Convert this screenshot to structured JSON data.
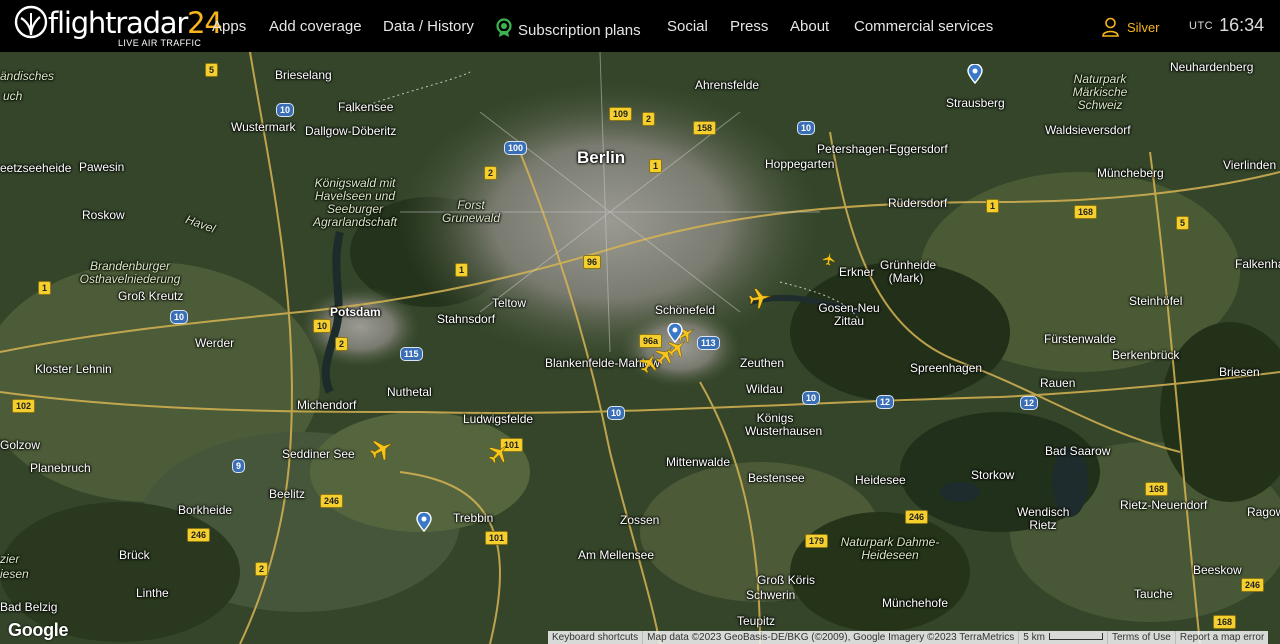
{
  "header": {
    "logo_text": "flightradar",
    "logo_number": "24",
    "logo_tagline": "LIVE AIR TRAFFIC",
    "nav": [
      {
        "label": "Apps"
      },
      {
        "label": "Add coverage"
      },
      {
        "label": "Data / History"
      },
      {
        "label": "Subscription plans"
      },
      {
        "label": "Social"
      },
      {
        "label": "Press"
      },
      {
        "label": "About"
      },
      {
        "label": "Commercial services"
      }
    ],
    "account_label": "Silver",
    "clock_zone": "UTC",
    "clock_time": "16:34",
    "accent_color": "#f8b61c"
  },
  "map": {
    "places": [
      {
        "name": "Berlin"
      },
      {
        "name": "Potsdam"
      },
      {
        "name": "Brieselang"
      },
      {
        "name": "Falkensee"
      },
      {
        "name": "Wustermark"
      },
      {
        "name": "Dallgow-Döberitz"
      },
      {
        "name": "Ahrensfelde"
      },
      {
        "name": "Hoppegarten"
      },
      {
        "name": "Petershagen-Eggersdorf"
      },
      {
        "name": "Strausberg"
      },
      {
        "name": "Neuhardenberg"
      },
      {
        "name": "Waldsieversdorf"
      },
      {
        "name": "Müncheberg"
      },
      {
        "name": "Vierlinden"
      },
      {
        "name": "Rüdersdorf"
      },
      {
        "name": "Erkner"
      },
      {
        "name": "Grünheide (Mark)"
      },
      {
        "name": "Gosen-Neu Zittau"
      },
      {
        "name": "Steinhöfel"
      },
      {
        "name": "Falkenha"
      },
      {
        "name": "Fürstenwalde"
      },
      {
        "name": "Berkenbrück"
      },
      {
        "name": "Briesen"
      },
      {
        "name": "Rauen"
      },
      {
        "name": "Spreenhagen"
      },
      {
        "name": "Schönefeld"
      },
      {
        "name": "Blankenfelde-Mahlow"
      },
      {
        "name": "Zeuthen"
      },
      {
        "name": "Wildau"
      },
      {
        "name": "Königs Wusterhausen"
      },
      {
        "name": "Teltow"
      },
      {
        "name": "Stahnsdorf"
      },
      {
        "name": "Nuthetal"
      },
      {
        "name": "Michendorf"
      },
      {
        "name": "Ludwigsfelde"
      },
      {
        "name": "Seddiner See"
      },
      {
        "name": "Beelitz"
      },
      {
        "name": "Trebbin"
      },
      {
        "name": "Mittenwalde"
      },
      {
        "name": "Bestensee"
      },
      {
        "name": "Heidesee"
      },
      {
        "name": "Storkow"
      },
      {
        "name": "Bad Saarow"
      },
      {
        "name": "Wendisch Rietz"
      },
      {
        "name": "Rietz-Neuendorf"
      },
      {
        "name": "Ragow"
      },
      {
        "name": "Beeskow"
      },
      {
        "name": "Tauche"
      },
      {
        "name": "Münchehofe"
      },
      {
        "name": "Groß Köris"
      },
      {
        "name": "Schwerin"
      },
      {
        "name": "Teupitz"
      },
      {
        "name": "Zossen"
      },
      {
        "name": "Am Mellensee"
      },
      {
        "name": "Pawesin"
      },
      {
        "name": "Roskow"
      },
      {
        "name": "Groß Kreutz"
      },
      {
        "name": "Werder"
      },
      {
        "name": "Kloster Lehnin"
      },
      {
        "name": "Golzow"
      },
      {
        "name": "Planebruch"
      },
      {
        "name": "Borkheide"
      },
      {
        "name": "Brück"
      },
      {
        "name": "Linthe"
      },
      {
        "name": "Bad Belzig"
      },
      {
        "name": "eetzseeheide"
      },
      {
        "name": "ändisches"
      },
      {
        "name": "uch"
      },
      {
        "name": "Havel"
      },
      {
        "name": "zier"
      },
      {
        "name": "iesen"
      }
    ],
    "parks": [
      {
        "name": "Königswald mit Havelseen und Seeburger Agrarlandschaft"
      },
      {
        "name": "Forst Grunewald"
      },
      {
        "name": "Brandenburger Osthavelniederung"
      },
      {
        "name": "Naturpark Märkische Schweiz"
      },
      {
        "name": "Naturpark Dahme-Heideseen"
      }
    ],
    "road_shields": [
      "5",
      "10",
      "2",
      "100",
      "109",
      "2",
      "158",
      "10",
      "1",
      "1",
      "168",
      "5",
      "1",
      "1",
      "96",
      "10",
      "2",
      "115",
      "10",
      "96a",
      "113",
      "10",
      "12",
      "12",
      "102",
      "9",
      "101",
      "246",
      "246",
      "2",
      "101",
      "179",
      "246",
      "168",
      "168",
      "246",
      "10"
    ],
    "footer": {
      "google": "Google",
      "keyboard": "Keyboard shortcuts",
      "map_data": "Map data ©2023 GeoBasis-DE/BKG (©2009), Google Imagery ©2023 TerraMetrics",
      "scale": "5 km",
      "terms": "Terms of Use",
      "report": "Report a map error"
    }
  }
}
